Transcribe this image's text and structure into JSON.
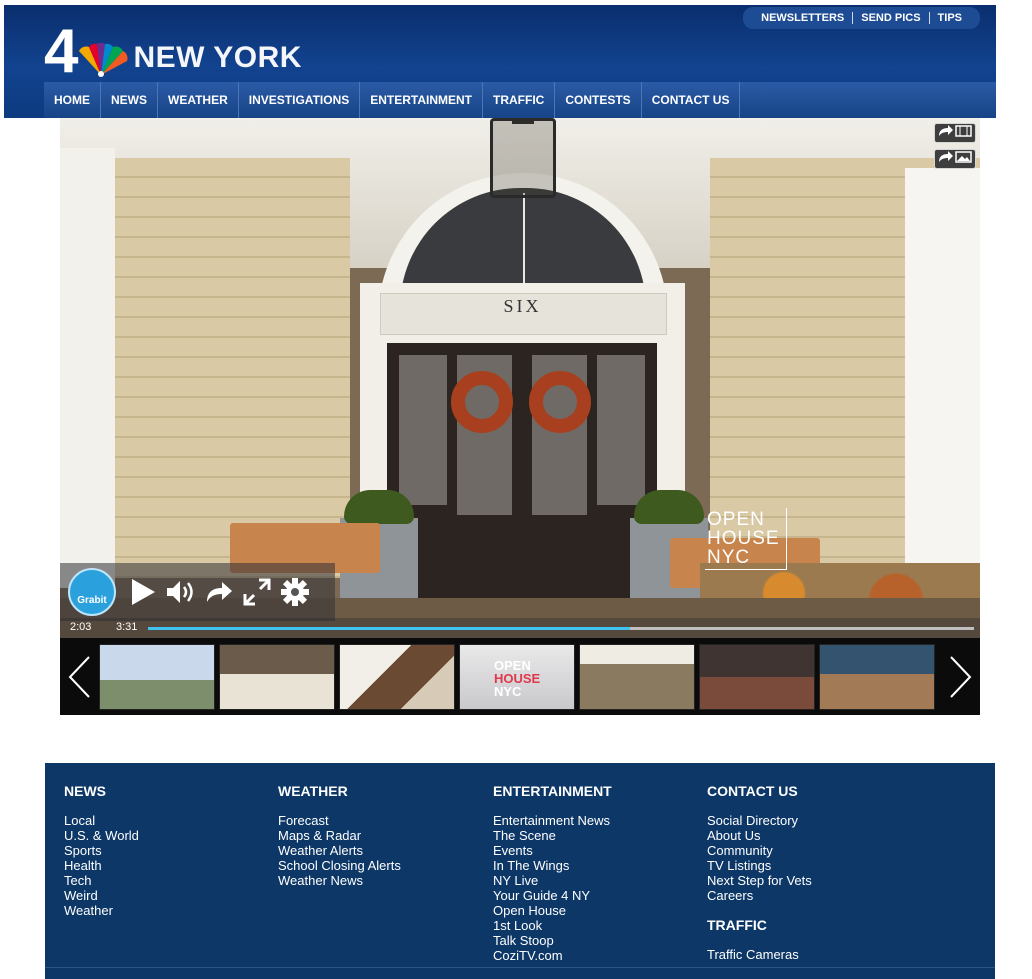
{
  "header": {
    "logo_number": "4",
    "logo_city": "NEW YORK",
    "top_links": [
      "NEWSLETTERS",
      "SEND PICS",
      "TIPS"
    ],
    "nav": [
      "HOME",
      "NEWS",
      "WEATHER",
      "INVESTIGATIONS",
      "ENTERTAINMENT",
      "TRAFFIC",
      "CONTESTS",
      "CONTACT US"
    ]
  },
  "video": {
    "door_sign": "SIX",
    "watermark": [
      "OPEN",
      "HOUSE",
      "NYC"
    ],
    "current_time": "2:03",
    "duration": "3:31",
    "progress": 0.583,
    "grabit_label": "Grabit",
    "icons": [
      "share-video-icon",
      "share-image-icon",
      "play-icon",
      "volume-icon",
      "share-icon",
      "fullscreen-icon",
      "settings-icon"
    ]
  },
  "thumbnails": {
    "thumb4_text": [
      "OPEN",
      "HOUSE",
      "NYC"
    ],
    "thumb4_colors": [
      "#ffffff",
      "#e0374b",
      "#ffffff"
    ]
  },
  "footer": {
    "news": {
      "title": "NEWS",
      "links": [
        "Local",
        "U.S. & World",
        "Sports",
        "Health",
        "Tech",
        "Weird",
        "Weather"
      ]
    },
    "weather": {
      "title": "WEATHER",
      "links": [
        "Forecast",
        "Maps & Radar",
        "Weather Alerts",
        "School Closing Alerts",
        "Weather News"
      ]
    },
    "entertainment": {
      "title": "ENTERTAINMENT",
      "links": [
        "Entertainment News",
        "The Scene",
        "Events",
        "In The Wings",
        "NY Live",
        "Your Guide 4 NY",
        "Open House",
        "1st Look",
        "Talk Stoop",
        "CoziTV.com"
      ]
    },
    "contact": {
      "title": "CONTACT US",
      "links": [
        "Social Directory",
        "About Us",
        "Community",
        "TV Listings",
        "Next Step for Vets",
        "Careers"
      ]
    },
    "traffic": {
      "title": "TRAFFIC",
      "links": [
        "Traffic Cameras"
      ]
    }
  },
  "colors": {
    "header_blue": "#12438f",
    "footer_blue": "#0c3767",
    "progress": "#3fc3ee"
  }
}
